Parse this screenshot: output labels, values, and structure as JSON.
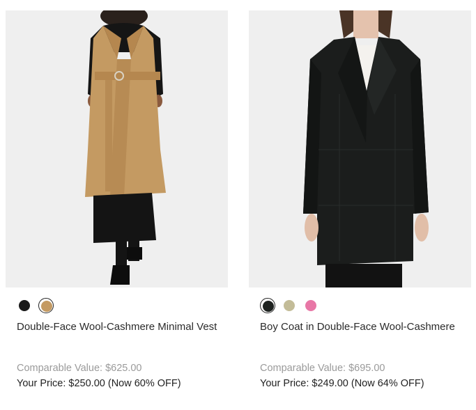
{
  "products": [
    {
      "image_alt": "Double-Face Wool-Cashmere Minimal Vest",
      "swatches": [
        {
          "color": "#1a1a1a",
          "selected": false
        },
        {
          "color": "#c49a62",
          "selected": true
        }
      ],
      "title": "Double-Face Wool-Cashmere Minimal Vest",
      "comparable": "Comparable Value: $625.00",
      "your_price": "Your Price: $250.00 (Now 60% OFF)"
    },
    {
      "image_alt": "Boy Coat in Double-Face Wool-Cashmere",
      "swatches": [
        {
          "color": "#1e2220",
          "selected": true
        },
        {
          "color": "#c3bc98",
          "selected": false
        },
        {
          "color": "#e877a6",
          "selected": false
        }
      ],
      "title": "Boy Coat in Double-Face Wool-Cashmere",
      "comparable": "Comparable Value: $695.00",
      "your_price": "Your Price: $249.00 (Now 64% OFF)"
    }
  ]
}
